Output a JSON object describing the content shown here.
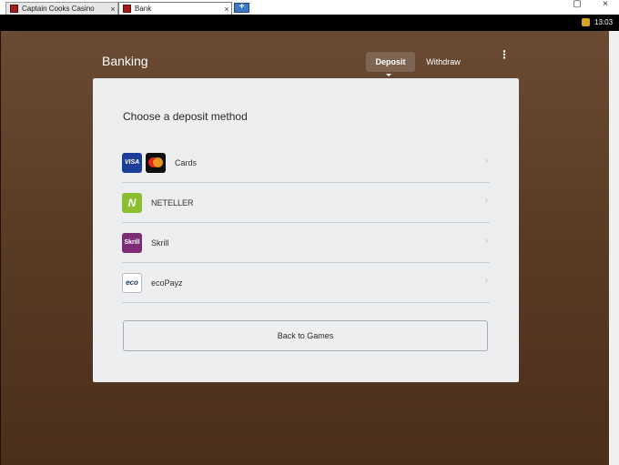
{
  "browser": {
    "tabs": [
      {
        "label": "Captain Cooks Casino",
        "close": "×"
      },
      {
        "label": "Bank",
        "close": "×"
      }
    ],
    "new_tab": "+",
    "window_controls": {
      "restore": "▢",
      "close": "×"
    },
    "clock": "13:03"
  },
  "header": {
    "title": "Banking",
    "deposit_tab": "Deposit",
    "withdraw_tab": "Withdraw",
    "menu_icon": "⋮"
  },
  "card": {
    "title": "Choose a deposit method",
    "methods": [
      {
        "label": "Cards",
        "logos": [
          "VISA",
          "mastercard"
        ]
      },
      {
        "label": "NETELLER",
        "logo_text": "N"
      },
      {
        "label": "Skrill",
        "logo_text": "Skrill"
      },
      {
        "label": "ecoPayz",
        "logo_text": "eco"
      }
    ],
    "chevron": "›",
    "back_button": "Back to Games"
  },
  "colors": {
    "background_top": "#6a4a33",
    "background_bottom": "#4a2f1b",
    "card": "#eceef0",
    "pill_active": "#7e6552"
  }
}
